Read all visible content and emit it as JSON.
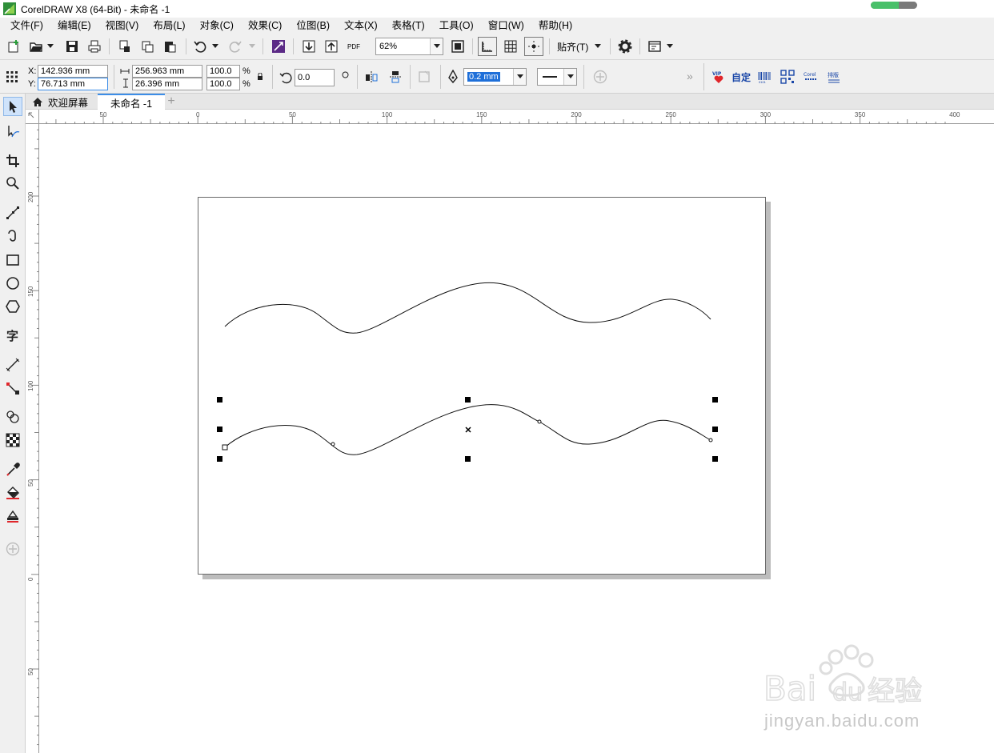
{
  "app": {
    "title": "CorelDRAW X8 (64-Bit) - 未命名 -1",
    "progress": 0.6,
    "logo_icon": "coreldraw-logo"
  },
  "menu": [
    "文件(F)",
    "编辑(E)",
    "视图(V)",
    "布局(L)",
    "对象(C)",
    "效果(C)",
    "位图(B)",
    "文本(X)",
    "表格(T)",
    "工具(O)",
    "窗口(W)",
    "帮助(H)"
  ],
  "toolbar": {
    "zoom_value": "62%",
    "snap_label": "贴齐(T)",
    "pdf_label": "PDF"
  },
  "property_bar": {
    "x_label": "X:",
    "y_label": "Y:",
    "x_value": "142.936 mm",
    "y_value": "76.713 mm",
    "width_value": "256.963 mm",
    "height_value": "26.396 mm",
    "scale_x": "100.0",
    "scale_y": "100.0",
    "percent": "%",
    "rotation": "0.0",
    "outline_width": "0.2 mm"
  },
  "plugins": [
    "VIP",
    "自定",
    "条码",
    "二维码",
    "Corel",
    "排版"
  ],
  "tabs": {
    "welcome": "欢迎屏幕",
    "document": "未命名 -1"
  },
  "rulers": {
    "horizontal": [
      "50",
      "0",
      "50",
      "100",
      "150",
      "200",
      "250",
      "300",
      "350",
      "400"
    ],
    "vertical": [
      "200",
      "150",
      "100",
      "50",
      "0",
      "50"
    ]
  },
  "watermark": {
    "brand": "Baidu 经验",
    "url": "jingyan.baidu.com"
  },
  "colors": {
    "accent": "#3d8ee8",
    "toolbar_bg": "#f0f0f0",
    "selection": "#000000"
  }
}
